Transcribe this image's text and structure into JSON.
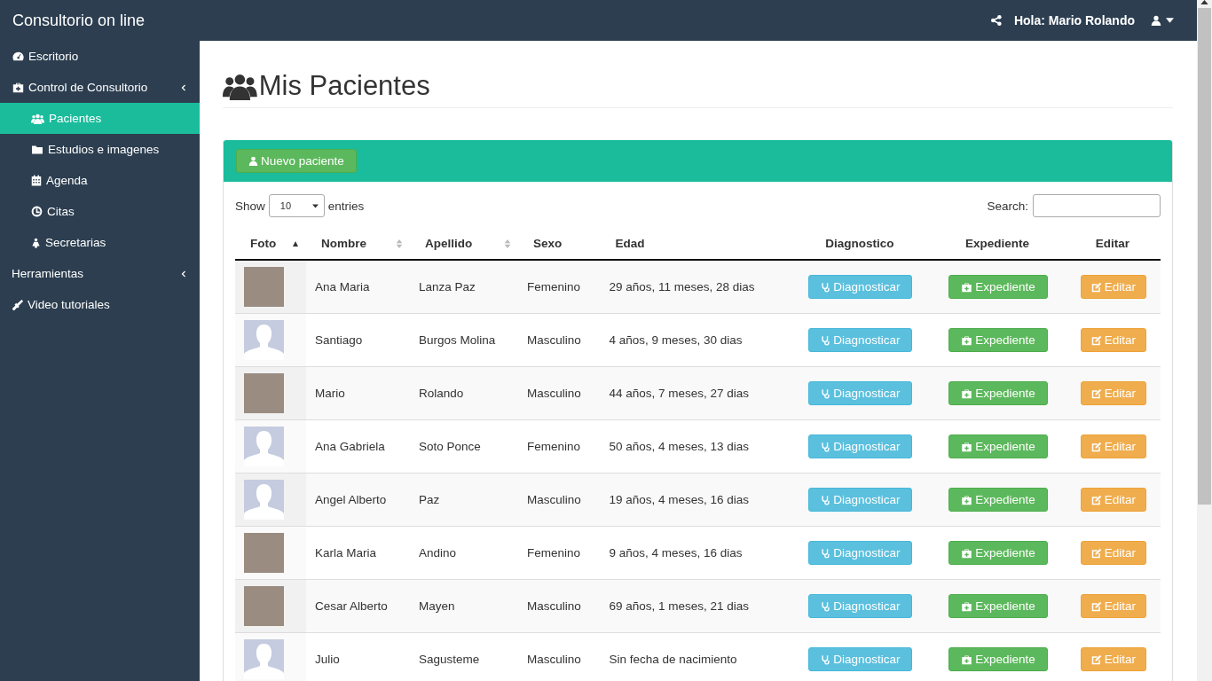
{
  "top_bar": {
    "brand": "Consultorio on line",
    "greeting": "Hola: Mario Rolando"
  },
  "sidebar": {
    "items": [
      {
        "label": "Escritorio",
        "kind": "link",
        "selected": false
      },
      {
        "label": "Control de Consultorio",
        "kind": "group",
        "selected": false,
        "children": [
          {
            "label": "Pacientes",
            "selected": true
          },
          {
            "label": "Estudios e imagenes",
            "selected": false
          },
          {
            "label": "Agenda",
            "selected": false
          },
          {
            "label": "Citas",
            "selected": false
          },
          {
            "label": "Secretarias",
            "selected": false
          }
        ]
      },
      {
        "label": "Herramientas",
        "kind": "group",
        "selected": false
      },
      {
        "label": "Video tutoriales",
        "kind": "link",
        "selected": false
      }
    ]
  },
  "page": {
    "title": "Mis Pacientes"
  },
  "panel": {
    "new_button": "Nuevo paciente",
    "show_label": "Show",
    "page_size": "10",
    "entries_label": "entries",
    "search_label": "Search:"
  },
  "table": {
    "columns": [
      {
        "label": "Foto",
        "kind": "sorted"
      },
      {
        "label": "Nombre",
        "kind": "sortable"
      },
      {
        "label": "Apellido",
        "kind": "sortable"
      },
      {
        "label": "Sexo",
        "kind": "plain"
      },
      {
        "label": "Edad",
        "kind": "plain"
      },
      {
        "label": "Diagnostico",
        "kind": "plain"
      },
      {
        "label": "Expediente",
        "kind": "plain"
      },
      {
        "label": "Editar",
        "kind": "plain"
      }
    ],
    "rows": [
      {
        "kind": "photo",
        "nombre": "Ana Maria",
        "apellido": "Lanza Paz",
        "sexo": "Femenino",
        "edad": "29 años, 11 meses, 28 dias",
        "diagnose": "Diagnosticar",
        "record": "Expediente",
        "edit": "Editar"
      },
      {
        "kind": "silhouette",
        "nombre": "Santiago",
        "apellido": "Burgos Molina",
        "sexo": "Masculino",
        "edad": "4 años, 9 meses, 30 dias",
        "diagnose": "Diagnosticar",
        "record": "Expediente",
        "edit": "Editar"
      },
      {
        "kind": "photo",
        "nombre": "Mario",
        "apellido": "Rolando",
        "sexo": "Masculino",
        "edad": "44 años, 7 meses, 27 dias",
        "diagnose": "Diagnosticar",
        "record": "Expediente",
        "edit": "Editar"
      },
      {
        "kind": "silhouette",
        "nombre": "Ana Gabriela",
        "apellido": "Soto Ponce",
        "sexo": "Femenino",
        "edad": "50 años, 4 meses, 13 dias",
        "diagnose": "Diagnosticar",
        "record": "Expediente",
        "edit": "Editar"
      },
      {
        "kind": "silhouette",
        "nombre": "Angel Alberto",
        "apellido": "Paz",
        "sexo": "Masculino",
        "edad": "19 años, 4 meses, 16 dias",
        "diagnose": "Diagnosticar",
        "record": "Expediente",
        "edit": "Editar"
      },
      {
        "kind": "photo",
        "nombre": "Karla Maria",
        "apellido": "Andino",
        "sexo": "Femenino",
        "edad": "9 años, 4 meses, 16 dias",
        "diagnose": "Diagnosticar",
        "record": "Expediente",
        "edit": "Editar"
      },
      {
        "kind": "photo",
        "nombre": "Cesar Alberto",
        "apellido": "Mayen",
        "sexo": "Masculino",
        "edad": "69 años, 1 meses, 21 dias",
        "diagnose": "Diagnosticar",
        "record": "Expediente",
        "edit": "Editar"
      },
      {
        "kind": "silhouette",
        "nombre": "Julio",
        "apellido": "Sagusteme",
        "sexo": "Masculino",
        "edad": "Sin fecha de nacimiento",
        "diagnose": "Diagnosticar",
        "record": "Expediente",
        "edit": "Editar"
      }
    ]
  }
}
